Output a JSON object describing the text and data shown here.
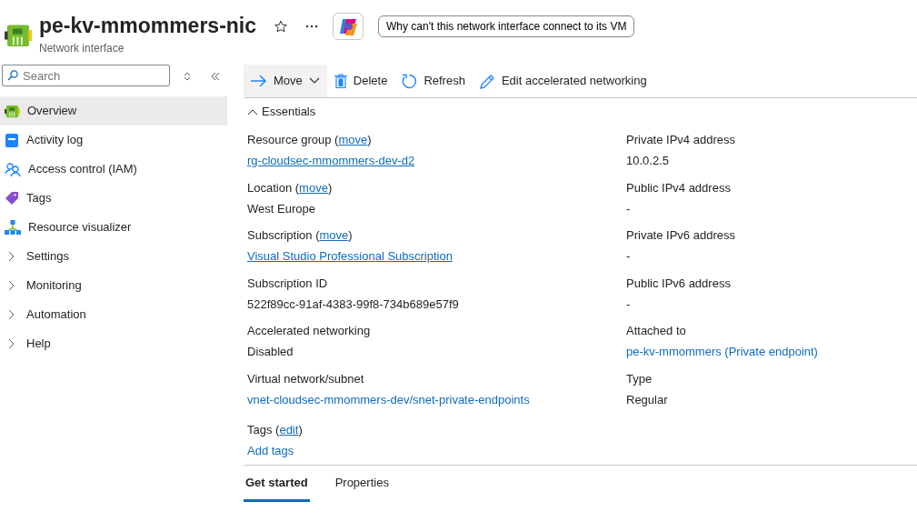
{
  "header": {
    "title": "pe-kv-mmommers-nic",
    "subtitle": "Network interface",
    "favorite": false,
    "copilot_prompt": "Why can't this network interface connect to its VM"
  },
  "sidebar": {
    "search": {
      "placeholder": "Search"
    },
    "items": [
      {
        "label": "Overview",
        "kind": "link",
        "selected": true
      },
      {
        "label": "Activity log",
        "kind": "link",
        "selected": false
      },
      {
        "label": "Access control (IAM)",
        "kind": "link",
        "selected": false
      },
      {
        "label": "Tags",
        "kind": "link",
        "selected": false
      },
      {
        "label": "Resource visualizer",
        "kind": "link",
        "selected": false
      },
      {
        "label": "Settings",
        "kind": "group",
        "expanded": false
      },
      {
        "label": "Monitoring",
        "kind": "group",
        "expanded": false
      },
      {
        "label": "Automation",
        "kind": "group",
        "expanded": false
      },
      {
        "label": "Help",
        "kind": "group",
        "expanded": false
      }
    ]
  },
  "toolbar": [
    {
      "label": "Move",
      "kind": "move",
      "dropdown": true,
      "selected": true
    },
    {
      "label": "Delete",
      "kind": "delete",
      "dropdown": false,
      "selected": false
    },
    {
      "label": "Refresh",
      "kind": "refresh",
      "dropdown": false,
      "selected": false
    },
    {
      "label": "Edit accelerated networking",
      "kind": "edit",
      "dropdown": false,
      "selected": false
    }
  ],
  "essentials": {
    "label": "Essentials",
    "expanded": true,
    "left": [
      {
        "label": "Resource group (",
        "action": "move",
        "label_end": ")",
        "value": "rg-cloudsec-mmommers-dev-d2",
        "kind": "link"
      },
      {
        "label": "Location (",
        "action": "move",
        "label_end": ")",
        "value": "West Europe",
        "kind": "text"
      },
      {
        "label": "Subscription (",
        "action": "move",
        "label_end": ")",
        "value": "Visual Studio Professional Subscription",
        "kind": "link"
      },
      {
        "label": "Subscription ID",
        "value": "522f89cc-91af-4383-99f8-734b689e57f9",
        "kind": "text"
      },
      {
        "label": "Accelerated networking",
        "value": "Disabled",
        "kind": "text"
      },
      {
        "label": "Virtual network/subnet",
        "value": "vnet-cloudsec-mmommers-dev/snet-private-endpoints",
        "kind": "plain-link"
      }
    ],
    "right": [
      {
        "label": "Private IPv4 address",
        "value": "10.0.2.5",
        "kind": "text"
      },
      {
        "label": "Public IPv4 address",
        "value": "-",
        "kind": "text"
      },
      {
        "label": "Private IPv6 address",
        "value": "-",
        "kind": "text"
      },
      {
        "label": "Public IPv6 address",
        "value": "-",
        "kind": "text"
      },
      {
        "label": "Attached to",
        "value": "pe-kv-mmommers (Private endpoint)",
        "kind": "plain-link"
      },
      {
        "label": "Type",
        "value": "Regular",
        "kind": "text"
      }
    ],
    "tags": {
      "label": "Tags (",
      "action": "edit",
      "label_end": ")",
      "value": "Add tags"
    }
  },
  "tabs": [
    {
      "label": "Get started",
      "selected": true
    },
    {
      "label": "Properties",
      "selected": false
    }
  ]
}
